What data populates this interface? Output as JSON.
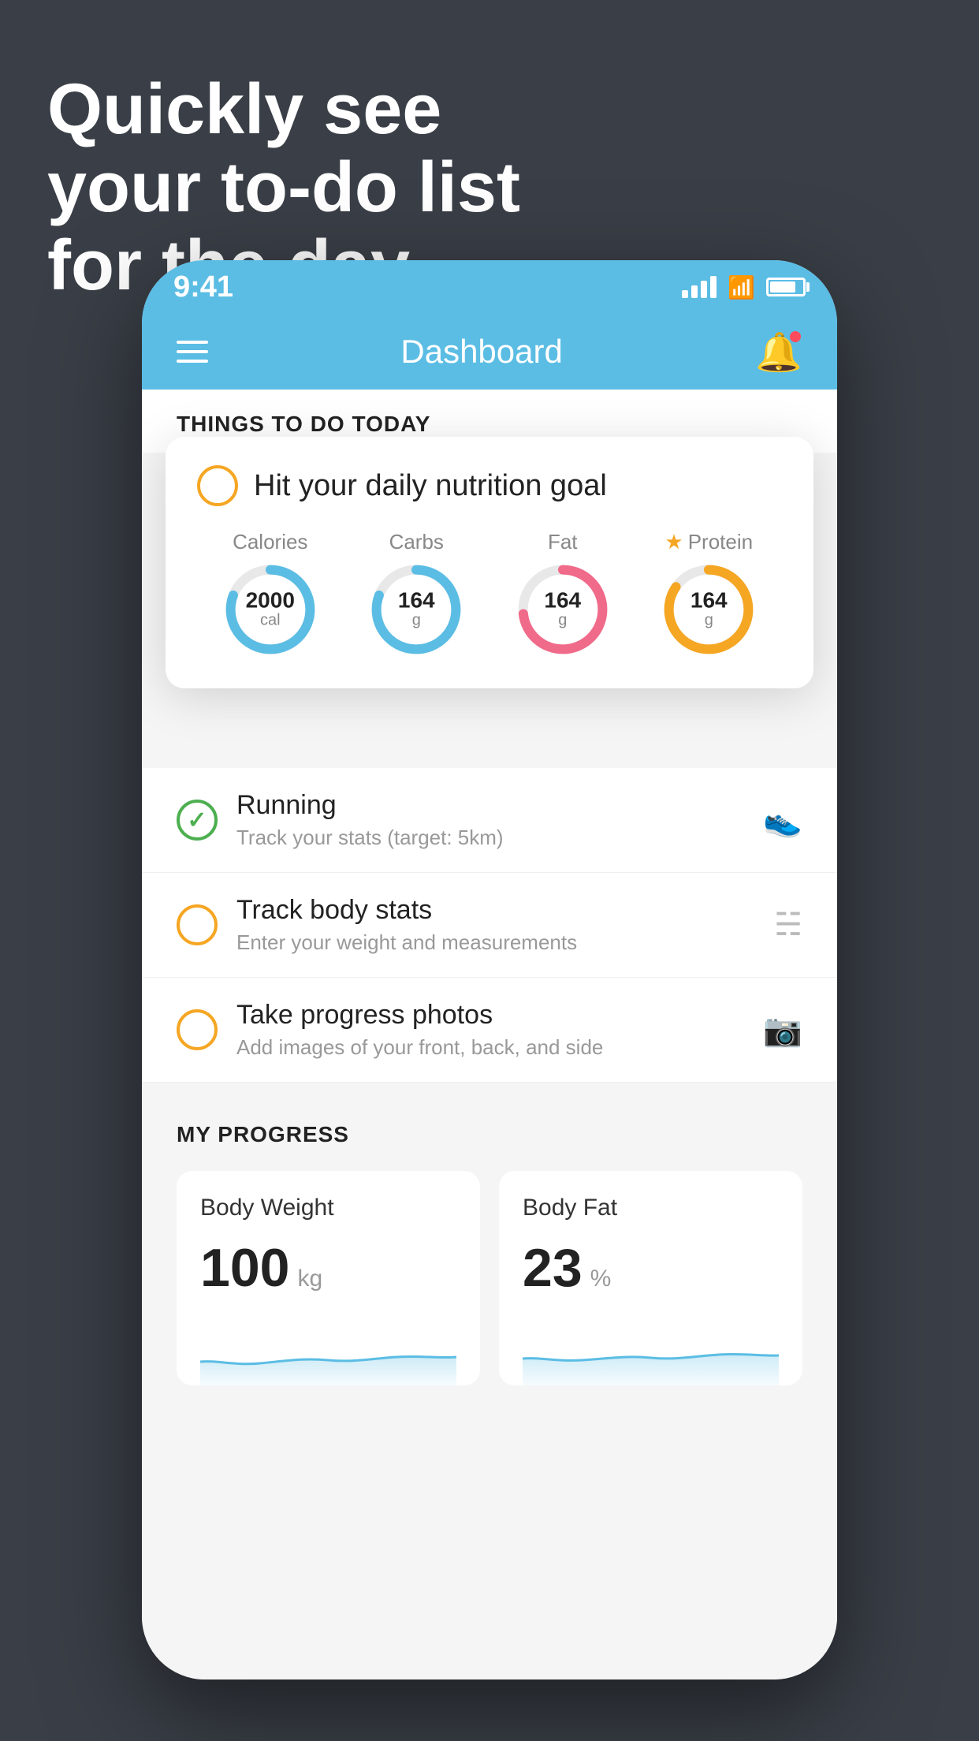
{
  "headline": {
    "line1": "Quickly see",
    "line2": "your to-do list",
    "line3": "for the day."
  },
  "statusBar": {
    "time": "9:41"
  },
  "header": {
    "title": "Dashboard"
  },
  "thingsToDoSection": {
    "heading": "THINGS TO DO TODAY"
  },
  "floatingCard": {
    "title": "Hit your daily nutrition goal",
    "nutrition": [
      {
        "label": "Calories",
        "value": "2000",
        "unit": "cal",
        "color": "blue",
        "starred": false
      },
      {
        "label": "Carbs",
        "value": "164",
        "unit": "g",
        "color": "blue",
        "starred": false
      },
      {
        "label": "Fat",
        "value": "164",
        "unit": "g",
        "color": "pink",
        "starred": false
      },
      {
        "label": "Protein",
        "value": "164",
        "unit": "g",
        "color": "yellow",
        "starred": true
      }
    ]
  },
  "todoItems": [
    {
      "id": "running",
      "title": "Running",
      "subtitle": "Track your stats (target: 5km)",
      "status": "complete",
      "icon": "shoe"
    },
    {
      "id": "body-stats",
      "title": "Track body stats",
      "subtitle": "Enter your weight and measurements",
      "status": "pending",
      "icon": "scale"
    },
    {
      "id": "progress-photos",
      "title": "Take progress photos",
      "subtitle": "Add images of your front, back, and side",
      "status": "pending",
      "icon": "photo"
    }
  ],
  "progressSection": {
    "heading": "MY PROGRESS",
    "cards": [
      {
        "title": "Body Weight",
        "value": "100",
        "unit": "kg"
      },
      {
        "title": "Body Fat",
        "value": "23",
        "unit": "%"
      }
    ]
  }
}
